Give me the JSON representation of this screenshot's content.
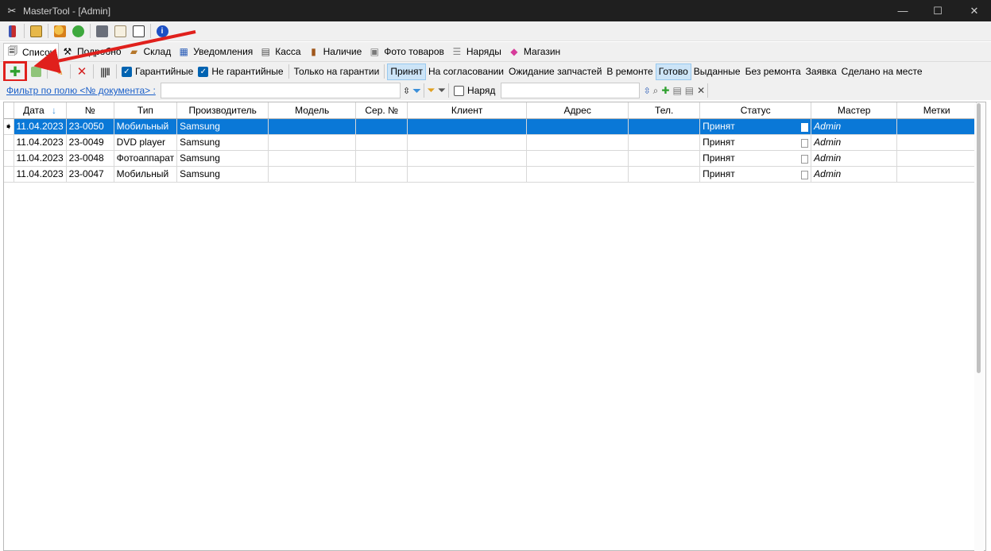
{
  "window": {
    "title": "MasterTool - [Admin]",
    "app_icon": "tools-icon",
    "controls": [
      "minimize-icon",
      "maximize-icon",
      "close-icon"
    ]
  },
  "toolbar_top": {
    "icons": [
      "book-icon",
      "search-doc-icon",
      "users-icon",
      "refresh-icon",
      "print-icon",
      "report-icon",
      "calculator-icon",
      "info-icon"
    ]
  },
  "tabs": [
    {
      "label": "Список",
      "icon": "list-icon",
      "active": true
    },
    {
      "label": "Подробно",
      "icon": "tools-icon"
    },
    {
      "label": "Склад",
      "icon": "truck-icon"
    },
    {
      "label": "Уведомления",
      "icon": "calendar-icon"
    },
    {
      "label": "Касса",
      "icon": "cash-register-icon"
    },
    {
      "label": "Наличие",
      "icon": "cabinet-icon"
    },
    {
      "label": "Фото товаров",
      "icon": "photo-icon"
    },
    {
      "label": "Наряды",
      "icon": "orders-icon"
    },
    {
      "label": "Магазин",
      "icon": "shopping-bag-icon"
    }
  ],
  "toolbar2": {
    "warranty_label": "Гарантийные",
    "warranty_checked": true,
    "non_warranty_label": "Не гарантийные",
    "non_warranty_checked": true,
    "only_warranty_label": "Только на гарантии",
    "statuses": [
      {
        "label": "Принят",
        "pressed": true
      },
      {
        "label": "На согласовании",
        "pressed": false
      },
      {
        "label": "Ожидание запчастей",
        "pressed": false
      },
      {
        "label": "В ремонте",
        "pressed": false
      },
      {
        "label": "Готово",
        "pressed": true
      },
      {
        "label": "Выданные",
        "pressed": false
      },
      {
        "label": "Без ремонта",
        "pressed": false
      },
      {
        "label": "Заявка",
        "pressed": false
      },
      {
        "label": "Сделано на месте",
        "pressed": false
      }
    ]
  },
  "filter": {
    "link_label": "Фильтр по полю <№ документа> :",
    "value": "",
    "order_label": "Наряд",
    "order_checked": false,
    "order_value": ""
  },
  "table": {
    "columns": [
      "Дата",
      "№",
      "Тип",
      "Производитель",
      "Модель",
      "Сер. №",
      "Клиент",
      "Адрес",
      "Тел.",
      "Статус",
      "Мастер",
      "Метки"
    ],
    "rows": [
      {
        "date": "11.04.2023",
        "num": "23-0050",
        "type": "Мобильный",
        "maker": "Samsung",
        "model": "",
        "serial": "",
        "client": "",
        "address": "",
        "phone": "",
        "status": "Принят",
        "master": "Admin",
        "tags": "",
        "selected": true
      },
      {
        "date": "11.04.2023",
        "num": "23-0049",
        "type": "DVD player",
        "maker": "Samsung",
        "model": "",
        "serial": "",
        "client": "",
        "address": "",
        "phone": "",
        "status": "Принят",
        "master": "Admin",
        "tags": "",
        "selected": false
      },
      {
        "date": "11.04.2023",
        "num": "23-0048",
        "type": "Фотоаппарат",
        "maker": "Samsung",
        "model": "",
        "serial": "",
        "client": "",
        "address": "",
        "phone": "",
        "status": "Принят",
        "master": "Admin",
        "tags": "",
        "selected": false
      },
      {
        "date": "11.04.2023",
        "num": "23-0047",
        "type": "Мобильный",
        "maker": "Samsung",
        "model": "",
        "serial": "",
        "client": "",
        "address": "",
        "phone": "",
        "status": "Принят",
        "master": "Admin",
        "tags": "",
        "selected": false
      }
    ]
  },
  "colors": {
    "selection": "#0a78d7",
    "highlight_box": "#e0201c",
    "pressed_button": "#cce4f7"
  }
}
